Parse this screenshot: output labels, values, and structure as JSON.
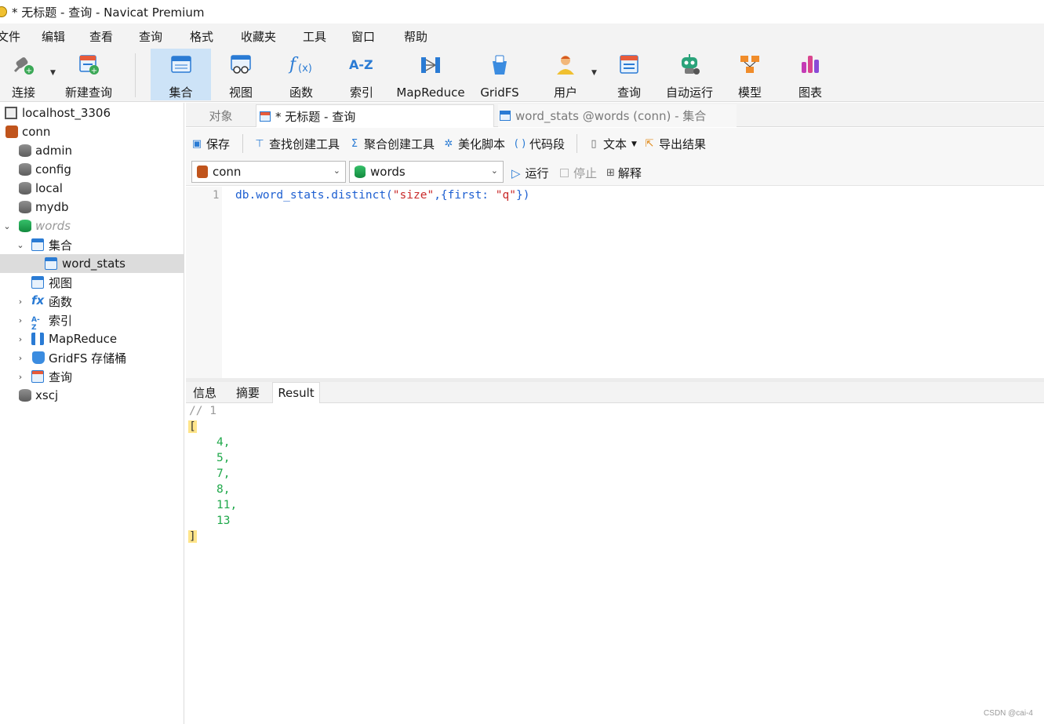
{
  "window": {
    "title": "* 无标题 - 查询 - Navicat Premium"
  },
  "menu": [
    "文件",
    "编辑",
    "查看",
    "查询",
    "格式",
    "收藏夹",
    "工具",
    "窗口",
    "帮助"
  ],
  "toolbar": {
    "connect": "连接",
    "new_query": "新建查询",
    "collection": "集合",
    "view": "视图",
    "function": "函数",
    "index": "索引",
    "mapreduce": "MapReduce",
    "gridfs": "GridFS",
    "user": "用户",
    "query": "查询",
    "automation": "自动运行",
    "model": "模型",
    "chart": "图表"
  },
  "sidebar": {
    "host": "localhost_3306",
    "conn": "conn",
    "dbs": [
      "admin",
      "config",
      "local",
      "mydb"
    ],
    "words": "words",
    "collections_group": "集合",
    "collection_item": "word_stats",
    "views_group": "视图",
    "functions_group": "函数",
    "index_group": "索引",
    "mapreduce_group": "MapReduce",
    "gridfs_group": "GridFS 存储桶",
    "query_group": "查询",
    "xscj": "xscj"
  },
  "tabs": {
    "objects": "对象",
    "query": "* 无标题 - 查询",
    "collection": "word_stats @words (conn) - 集合"
  },
  "actions": {
    "save": "保存",
    "find_builder": "查找创建工具",
    "aggregate_builder": "聚合创建工具",
    "beautify": "美化脚本",
    "snippet": "代码段",
    "text": "文本",
    "export": "导出结果"
  },
  "selectors": {
    "connection": "conn",
    "database": "words",
    "run": "运行",
    "stop": "停止",
    "explain": "解释"
  },
  "editor": {
    "line_number": "1",
    "code_prefix": "db.word_stats.distinct(",
    "code_str1": "\"size\"",
    "code_mid": ",{first: ",
    "code_str2": "\"q\"",
    "code_suffix": "})"
  },
  "result_tabs": {
    "info": "信息",
    "summary": "摘要",
    "result": "Result"
  },
  "result": {
    "comment": "// 1",
    "open": "[",
    "close": "]",
    "values": [
      "4,",
      "5,",
      "7,",
      "8,",
      "11,",
      "13"
    ]
  },
  "watermark": "CSDN @cai-4"
}
